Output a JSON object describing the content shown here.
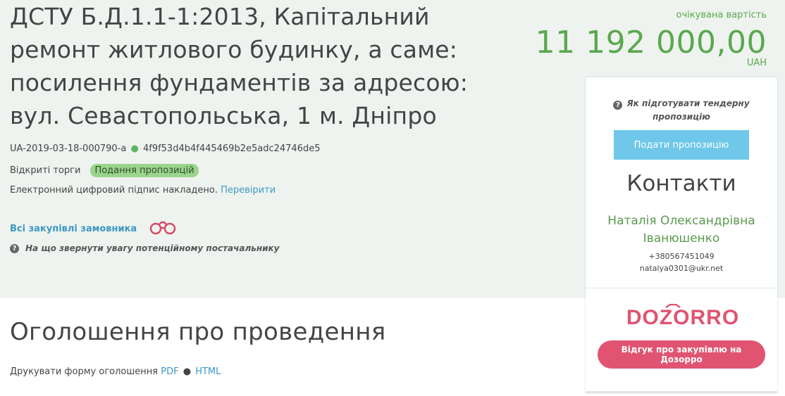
{
  "tender": {
    "title": "ДСТУ Б.Д.1.1-1:2013, Капітальний ремонт житлового будинку, а саме: посилення фундаментів за адресою: вул. Севастопольська, 1 м. Дніпро",
    "tender_id": "UA-2019-03-18-000790-a",
    "hash": "4f9f53d4b4f445469b2e5adc24746de5",
    "procedure_type": "Відкриті торги",
    "status": "Подання пропозицій",
    "signature_text": "Електронний цифровий підпис накладено.",
    "verify_link": "Перевірити",
    "all_purchases_link": "Всі закупівлі замовника",
    "hint_text": "На що звернути увагу потенційному постачальнику"
  },
  "price": {
    "label": "очікувана вартість",
    "value": "11 192 000,00",
    "currency": "UAH"
  },
  "side_panel": {
    "how_to_prepare": "Як підготувати тендерну пропозицію",
    "submit_button": "Подати пропозицію",
    "contacts_title": "Контакти",
    "contact_name": "Наталія Олександрівна Іванюшенко",
    "contact_phone": "+380567451049",
    "contact_email": "natalya0301@ukr.net",
    "dozorro_logo": "DOZORRO",
    "dozorro_button": "Відгук про закупівлю на Дозорро"
  },
  "announcement": {
    "title": "Оголошення про проведення",
    "print_text": "Друкувати форму оголошення",
    "pdf_link": "PDF",
    "html_link": "HTML"
  },
  "colors": {
    "band_bg": "#eef3ef",
    "green": "#5aa84e",
    "link": "#3d97c4",
    "submit": "#6fc7e9",
    "dozorro": "#e05471"
  },
  "icons": {
    "question": "question-circle-icon",
    "binoculars": "binoculars-icon"
  }
}
